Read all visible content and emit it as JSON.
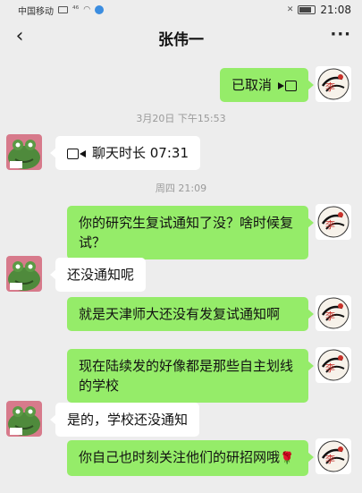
{
  "status_bar": {
    "carrier": "中国移动",
    "icons": [
      "message-icon",
      "wifi-icon",
      "notification-icon"
    ],
    "right_icons": [
      "mute-icon",
      "battery-icon"
    ],
    "time": "21:08"
  },
  "nav": {
    "back_icon": "‹",
    "title": "张伟一",
    "more_icon": "···"
  },
  "messages": [
    {
      "side": "right",
      "text": "已取消",
      "icon": "video-call-icon"
    },
    {
      "type": "timestamp",
      "text": "3月20日 下午15:53"
    },
    {
      "side": "left",
      "text": "聊天时长 07:31",
      "icon": "video-call-icon"
    },
    {
      "type": "timestamp",
      "text": "周四 21:09"
    },
    {
      "side": "right",
      "text": "你的研究生复试通知了没？啥时候复试？"
    },
    {
      "side": "left",
      "text": "还没通知呢"
    },
    {
      "side": "right",
      "text": "就是天津师大还没有发复试通知啊"
    },
    {
      "side": "right",
      "text": "现在陆续发的好像都是那些自主划线的学校"
    },
    {
      "side": "left",
      "text": "是的，学校还没通知"
    },
    {
      "side": "right",
      "text": "你自己也时刻关注他们的研招网哦",
      "emoji": "🌹"
    }
  ],
  "colors": {
    "background": "#ededed",
    "bubble_sent": "#95ec69",
    "bubble_received": "#ffffff",
    "timestamp": "#9a9a9a"
  }
}
